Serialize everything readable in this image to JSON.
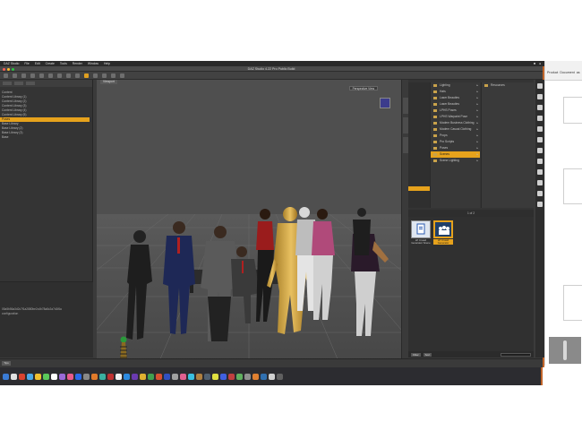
{
  "app": {
    "title": "DAZ Studio 4.22 Pro Public Build"
  },
  "menubar": {
    "items": [
      "DAZ Studio",
      "File",
      "Edit",
      "Create",
      "Tools",
      "Render",
      "Window",
      "Help"
    ],
    "right_items": [
      "■",
      "●"
    ]
  },
  "bg_window": {
    "tabs": [
      "Product",
      "Document",
      "as"
    ]
  },
  "left_panel": {
    "items": [
      {
        "label": "Content",
        "selected": false
      },
      {
        "label": "Content Library (1)",
        "selected": false
      },
      {
        "label": "Content Library (2)",
        "selected": false
      },
      {
        "label": "Content Library (3)",
        "selected": false
      },
      {
        "label": "Content Library (4)",
        "selected": false
      },
      {
        "label": "Content Library (5)",
        "selected": false
      },
      {
        "label": "Poses",
        "selected": true
      },
      {
        "label": "Base Library",
        "selected": false
      },
      {
        "label": "Base Library (2)",
        "selected": false
      },
      {
        "label": "Base Library (3)",
        "selected": false
      },
      {
        "label": "Base",
        "selected": false
      }
    ],
    "lower_text_1": "05a5b56a3d2c7f1a2880be2c4b78a8c2a7d1f6a",
    "lower_text_2": "configuration"
  },
  "viewport": {
    "tab_label": "Viewport",
    "camera_label": "Perspective View"
  },
  "content_library": {
    "tree": [
      {
        "label": "Lighting",
        "selected": false
      },
      {
        "label": "Hats",
        "selected": false
      },
      {
        "label": "Laser Beauties",
        "selected": false
      },
      {
        "label": "Laser Beauties",
        "selected": false
      },
      {
        "label": "LPHS Poses",
        "selected": false
      },
      {
        "label": "LPHS Warpaint Pose",
        "selected": false
      },
      {
        "label": "Modern Business Clothing",
        "selected": false
      },
      {
        "label": "Modern Casual Clothing",
        "selected": false
      },
      {
        "label": "Props",
        "selected": false
      },
      {
        "label": "Pro Scripts",
        "selected": false
      },
      {
        "label": "Poses",
        "selected": false
      },
      {
        "label": "Scenes",
        "selected": true
      },
      {
        "label": "Scene Lighting",
        "selected": false
      }
    ],
    "folder": "Resources",
    "assets_header": "1 of 2",
    "assets": [
      {
        "label": "LP Crowd Generator Scene",
        "selected": false
      },
      {
        "label": "LP Crowd Generator",
        "selected": true
      }
    ],
    "footer_buttons": [
      "Filter",
      "Sort"
    ]
  },
  "status": {
    "button_label": "Tips"
  },
  "colors": {
    "accent": "#e6a21c",
    "window_border": "#c0642a",
    "panel_bg": "#343434",
    "viewport_bg": "#4e4e4e"
  },
  "icons": {
    "toolbar": [
      "new-icon",
      "open-icon",
      "save-icon",
      "undo-icon",
      "redo-icon",
      "select-icon",
      "move-icon",
      "rotate-icon",
      "scale-icon",
      "render-icon"
    ],
    "side_tools": [
      "home-icon",
      "eye-icon",
      "camera-icon",
      "light-icon",
      "globe-icon",
      "gear-icon",
      "brush-icon",
      "figure-icon",
      "hand-icon",
      "zoom-icon",
      "grid-icon",
      "info-icon",
      "plus-icon",
      "minus-icon",
      "settings-icon"
    ]
  }
}
